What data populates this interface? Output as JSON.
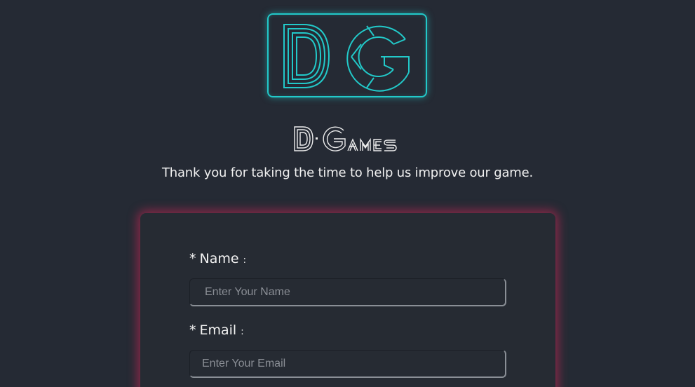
{
  "brand": {
    "logo_monogram": "DG",
    "name": "D-GAMES"
  },
  "tagline": "Thank you for taking the time to help us improve our game.",
  "form": {
    "fields": [
      {
        "required_marker": "*",
        "label": "Name",
        "colon": ":",
        "placeholder": "Enter Your Name",
        "value": ""
      },
      {
        "required_marker": "*",
        "label": "Email",
        "colon": ":",
        "placeholder": "Enter Your Email",
        "value": ""
      }
    ]
  },
  "colors": {
    "background": "#252a34",
    "logo_accent": "#22c9c9",
    "card_glow": "#dc285a"
  }
}
